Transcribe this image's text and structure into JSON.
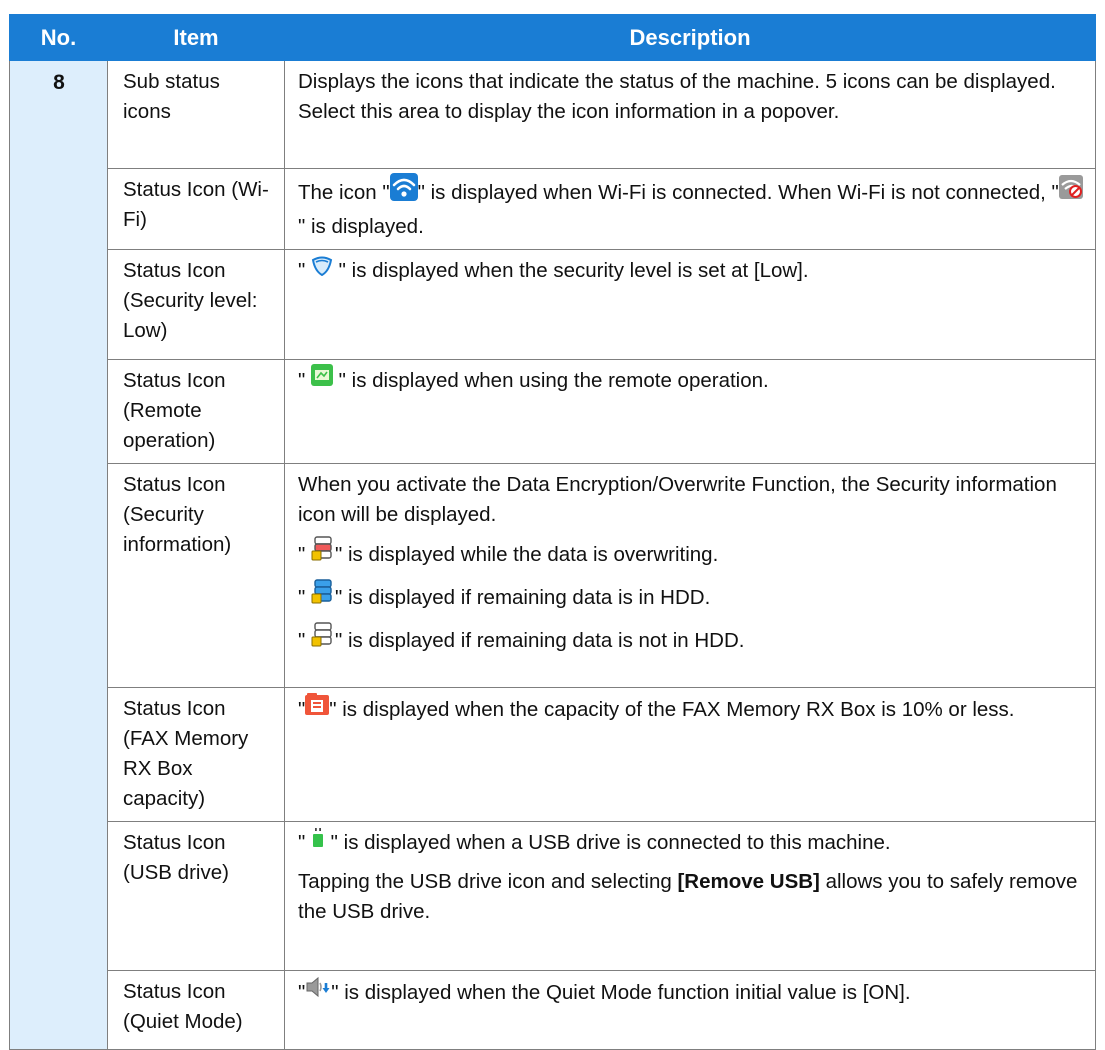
{
  "headers": {
    "no": "No.",
    "item": "Item",
    "description": "Description"
  },
  "number": "8",
  "rows": [
    {
      "item": "Sub status icons",
      "desc": [
        "Displays the icons that indicate the status of the machine. 5 icons can be displayed. Select this area to display the icon information in a popover."
      ]
    },
    {
      "item": "Status Icon (Wi-Fi)",
      "desc_a": "The icon \"",
      "desc_b": "\" is displayed when Wi-Fi is connected. When Wi-Fi is not connected, \"",
      "desc_c": "\" is displayed."
    },
    {
      "item": "Status Icon (Security level: Low)",
      "desc_a": "\" ",
      "desc_b": " \" is displayed when the security level is set at [Low]."
    },
    {
      "item": "Status Icon (Remote operation)",
      "desc_a": "\" ",
      "desc_b": " \" is displayed when using the remote operation."
    },
    {
      "item": "Status Icon (Security information)",
      "desc_intro": "When you activate the Data Encryption/Overwrite Function, the Security information icon will be displayed.",
      "lines": [
        {
          "a": "\" ",
          "b": "\" is displayed while the data is overwriting."
        },
        {
          "a": "\" ",
          "b": "\" is displayed if remaining data is in HDD."
        },
        {
          "a": "\" ",
          "b": "\" is displayed if remaining data is not in HDD."
        }
      ]
    },
    {
      "item": "Status Icon (FAX Memory RX Box capacity)",
      "desc_a": "\"",
      "desc_b": "\" is displayed when the capacity of the FAX Memory RX Box is 10% or less."
    },
    {
      "item": "Status Icon (USB drive)",
      "desc_a": "\" ",
      "desc_b": " \" is displayed when a USB drive is connected to this machine.",
      "desc_p2_a": "Tapping the USB drive icon and selecting ",
      "desc_p2_bold": "[Remove USB]",
      "desc_p2_b": " allows you to safely remove the USB drive."
    },
    {
      "item": "Status Icon (Quiet Mode)",
      "desc_a": "\"",
      "desc_b": "\" is displayed when the Quiet Mode function initial value is [ON]."
    }
  ],
  "icons": {
    "wifi": "wifi-connected-icon",
    "wifi_off": "wifi-disconnected-icon",
    "security_low": "security-low-shield-icon",
    "remote": "remote-operation-icon",
    "overwriting": "data-overwriting-icon",
    "data_in_hdd": "data-in-hdd-icon",
    "data_not_in_hdd": "data-not-in-hdd-icon",
    "fax_memory": "fax-memory-rx-box-icon",
    "usb": "usb-drive-icon",
    "quiet": "quiet-mode-icon"
  },
  "colors": {
    "header_bg": "#1a7dd4",
    "number_bg": "#ddeefc",
    "border": "#7f7f7f"
  }
}
